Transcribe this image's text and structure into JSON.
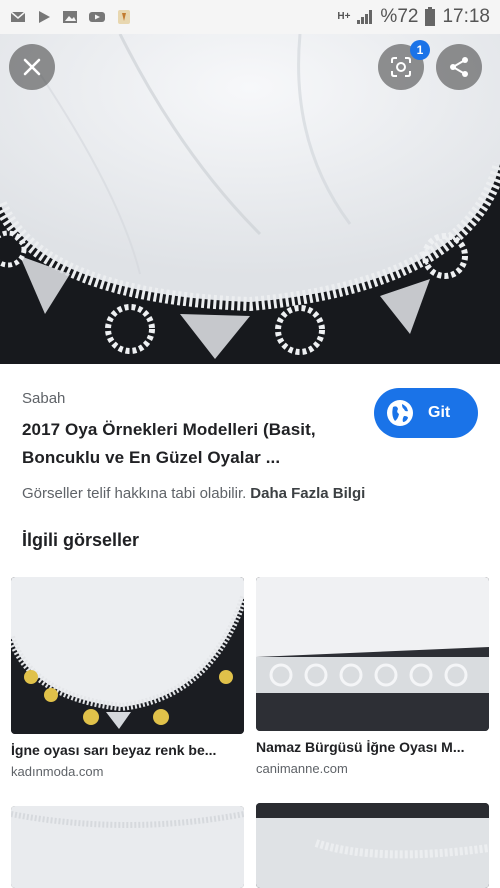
{
  "status_bar": {
    "network": "H+",
    "battery": "%72",
    "time": "17:18",
    "icons": [
      "email-icon",
      "play-store-icon",
      "gallery-icon",
      "youtube-icon",
      "app-icon"
    ]
  },
  "viewer": {
    "lens_badge": "1"
  },
  "result": {
    "source": "Sabah",
    "title_line1": "2017 Oya Örnekleri Modelleri (Basit,",
    "title_line2": "Boncuklu ve En Güzel Oyalar ...",
    "go_label": "Git",
    "copyright_text": "Görseller telif hakkına tabi olabilir.",
    "more_info": "Daha Fazla Bilgi"
  },
  "related": {
    "heading": "İlgili görseller",
    "items": [
      {
        "caption": "İgne oyası sarı beyaz renk be...",
        "domain": "kadınmoda.com"
      },
      {
        "caption": "Namaz Bürgüsü İğne Oyası M...",
        "domain": "canimanne.com"
      },
      {
        "caption": "",
        "domain": ""
      },
      {
        "caption": "",
        "domain": ""
      }
    ]
  },
  "colors": {
    "accent": "#1a73e8",
    "fabric": "#f2f3f5",
    "background_dark": "#1a1c20"
  }
}
